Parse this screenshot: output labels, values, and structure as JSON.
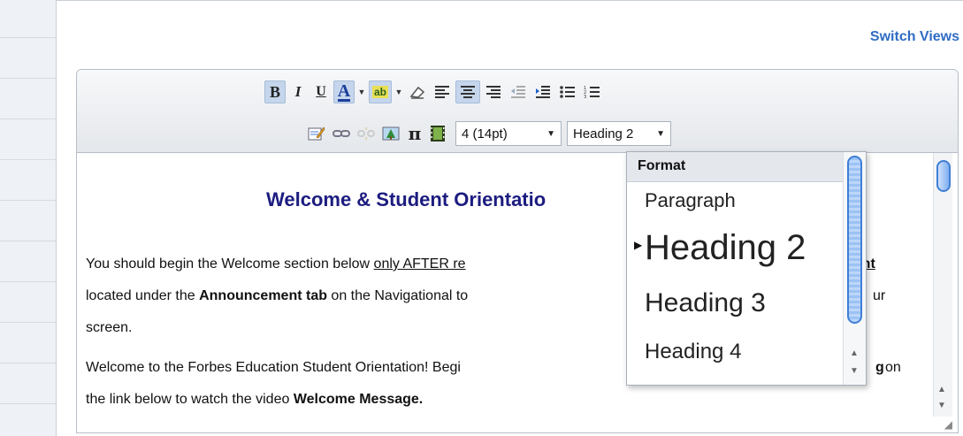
{
  "header": {
    "switch_views": "Switch Views"
  },
  "toolbar": {
    "bold": "B",
    "italic": "I",
    "underline": "U",
    "font_color": "A",
    "highlight": "ab",
    "pi": "π",
    "font_size": "4 (14pt)",
    "format": "Heading 2"
  },
  "content": {
    "title": "Welcome & Student Orientatio",
    "line1_a": "You should begin the Welcome section below ",
    "line1_u": "only AFTER re",
    "line1_b": "nent",
    "line2_a": "located under the ",
    "line2_b": "Announcement tab",
    "line2_c": " on the Navigational to",
    "line2_d": "ur",
    "line3": "screen.",
    "line4_a": "Welcome to the Forbes Education Student Orientation! Begi",
    "line4_b": "g",
    "line4_c": " on",
    "line5_a": "the link below to watch the video ",
    "line5_b": "Welcome Message."
  },
  "format_menu": {
    "header": "Format",
    "items": [
      "Paragraph",
      "Heading 2",
      "Heading 3",
      "Heading 4"
    ]
  },
  "colors": {
    "link": "#2f6cc4",
    "title": "#1c1c80",
    "active": "#c5d6ec",
    "scroll": "#3f7fd6"
  }
}
